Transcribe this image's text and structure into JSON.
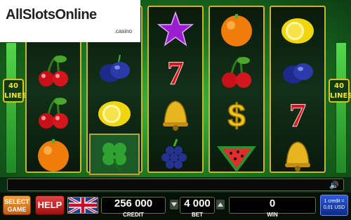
{
  "logo": {
    "main": "AllSlotsOnline",
    "sub": ".casino"
  },
  "lines_left": "40\nLINES",
  "lines_right": "40\nLINES",
  "reels": [
    [
      "cherries",
      "cherries",
      "orange"
    ],
    [
      "plum",
      "lemon",
      "clover"
    ],
    [
      "star",
      "seven",
      "bell",
      "grapes"
    ],
    [
      "orange",
      "cherries",
      "dollar",
      "watermelon"
    ],
    [
      "lemon",
      "plum",
      "seven",
      "bell"
    ]
  ],
  "buttons": {
    "select_game": "SELECT GAME",
    "help": "HELP"
  },
  "credit": {
    "value": "256 000",
    "label": "CREDIT"
  },
  "bet": {
    "value": "4 000",
    "label": "BET"
  },
  "win": {
    "value": "0",
    "label": "WIN"
  },
  "denomination": {
    "line1": "1 credit =",
    "line2": "0,01 USD"
  },
  "message": ""
}
